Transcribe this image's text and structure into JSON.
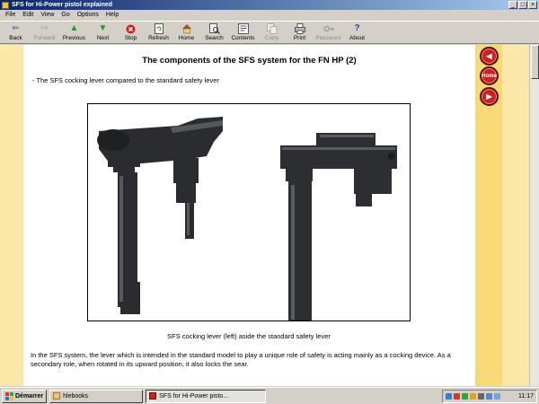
{
  "window": {
    "title": "SFS for Hi-Power pistol explained",
    "controls": {
      "minimize": "_",
      "maximize": "□",
      "close": "×"
    }
  },
  "menu": [
    "File",
    "Edit",
    "View",
    "Go",
    "Options",
    "Help"
  ],
  "toolbar": {
    "back": "Back",
    "forward": "Forward",
    "previous": "Previous",
    "next": "Next",
    "stop": "Stop",
    "refresh": "Refresh",
    "home": "Home",
    "search": "Search",
    "contents": "Contents",
    "copy": "Copy",
    "print": "Print",
    "password": "Password",
    "about": "About"
  },
  "page": {
    "title": "The components of the SFS system for the FN HP (2)",
    "subtitle": "- The SFS cocking lever compared to the standard safety lever",
    "caption": "SFS cocking lever (left) aside the standard safety lever",
    "body": "In the SFS system, the lever which is intended in the standard model to play a unique role of safety is acting mainly as a cocking device. As a secondary role, when rotated in its upward position, it also locks the sear."
  },
  "nav": {
    "home_label": "Home"
  },
  "taskbar": {
    "start": "Démarrer",
    "tasks": [
      "hlebooks",
      "SFS for Hi-Power pisto..."
    ],
    "clock": "11:17"
  },
  "colors": {
    "sidebar": "#fbe7a8",
    "sidebar_inner": "#f7d978",
    "nav_button": "#c8231e",
    "titlebar": "#0a246a"
  }
}
